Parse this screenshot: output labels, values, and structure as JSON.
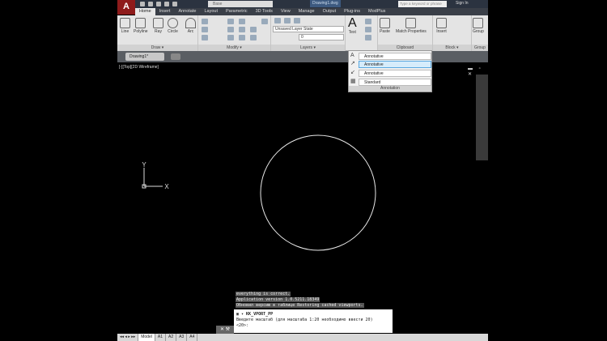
{
  "titlebar": {
    "logo": "A",
    "workspace": "Base",
    "document_title": "Drawing1.dwg",
    "search_placeholder": "Type a keyword or phrase",
    "sign_in": "Sign In"
  },
  "tabs": [
    "Home",
    "Insert",
    "Annotate",
    "Layout",
    "Parametric",
    "3D Tools",
    "View",
    "Manage",
    "Output",
    "Plug-ins",
    "ModPlus"
  ],
  "ribbon": {
    "draw": {
      "label": "Draw ▾",
      "tools": [
        "Line",
        "Polyline",
        "Ray",
        "Circle",
        "Arc"
      ]
    },
    "modify": {
      "label": "Modify ▾"
    },
    "layers": {
      "label": "Layers ▾",
      "layer_state": "Unsaved Layer State",
      "current_layer": "0"
    },
    "text": {
      "label": "Text"
    },
    "clipboard": {
      "label": "Clipboard",
      "tools": [
        "Paste",
        "Match Properties"
      ]
    },
    "block": {
      "label": "Block ▾",
      "tools": [
        "Insert"
      ]
    },
    "group": {
      "label": "Group",
      "tools": [
        "Group"
      ]
    }
  },
  "annotation_panel": {
    "label": "Annotation",
    "rows": [
      "Annotative",
      "Annotative",
      "Annotative",
      "Standard"
    ]
  },
  "document_tab": "Drawing1*",
  "viewport_label": "[-][Top][2D Wireframe]",
  "ucs": {
    "x": "X",
    "y": "Y"
  },
  "command_history": [
    "everything is correct.",
    "Application version 1.0.5211.18349",
    "Обновил версию в таблице Restoring cached viewports."
  ],
  "command": {
    "name": "KK_VPORT_PP",
    "prompt": "Введите масштаб (для масштаба 1:20 необходимо ввести 20)",
    "default": "<20>:"
  },
  "layout_tabs": [
    "Model",
    "A1",
    "A2",
    "A3",
    "A4"
  ]
}
